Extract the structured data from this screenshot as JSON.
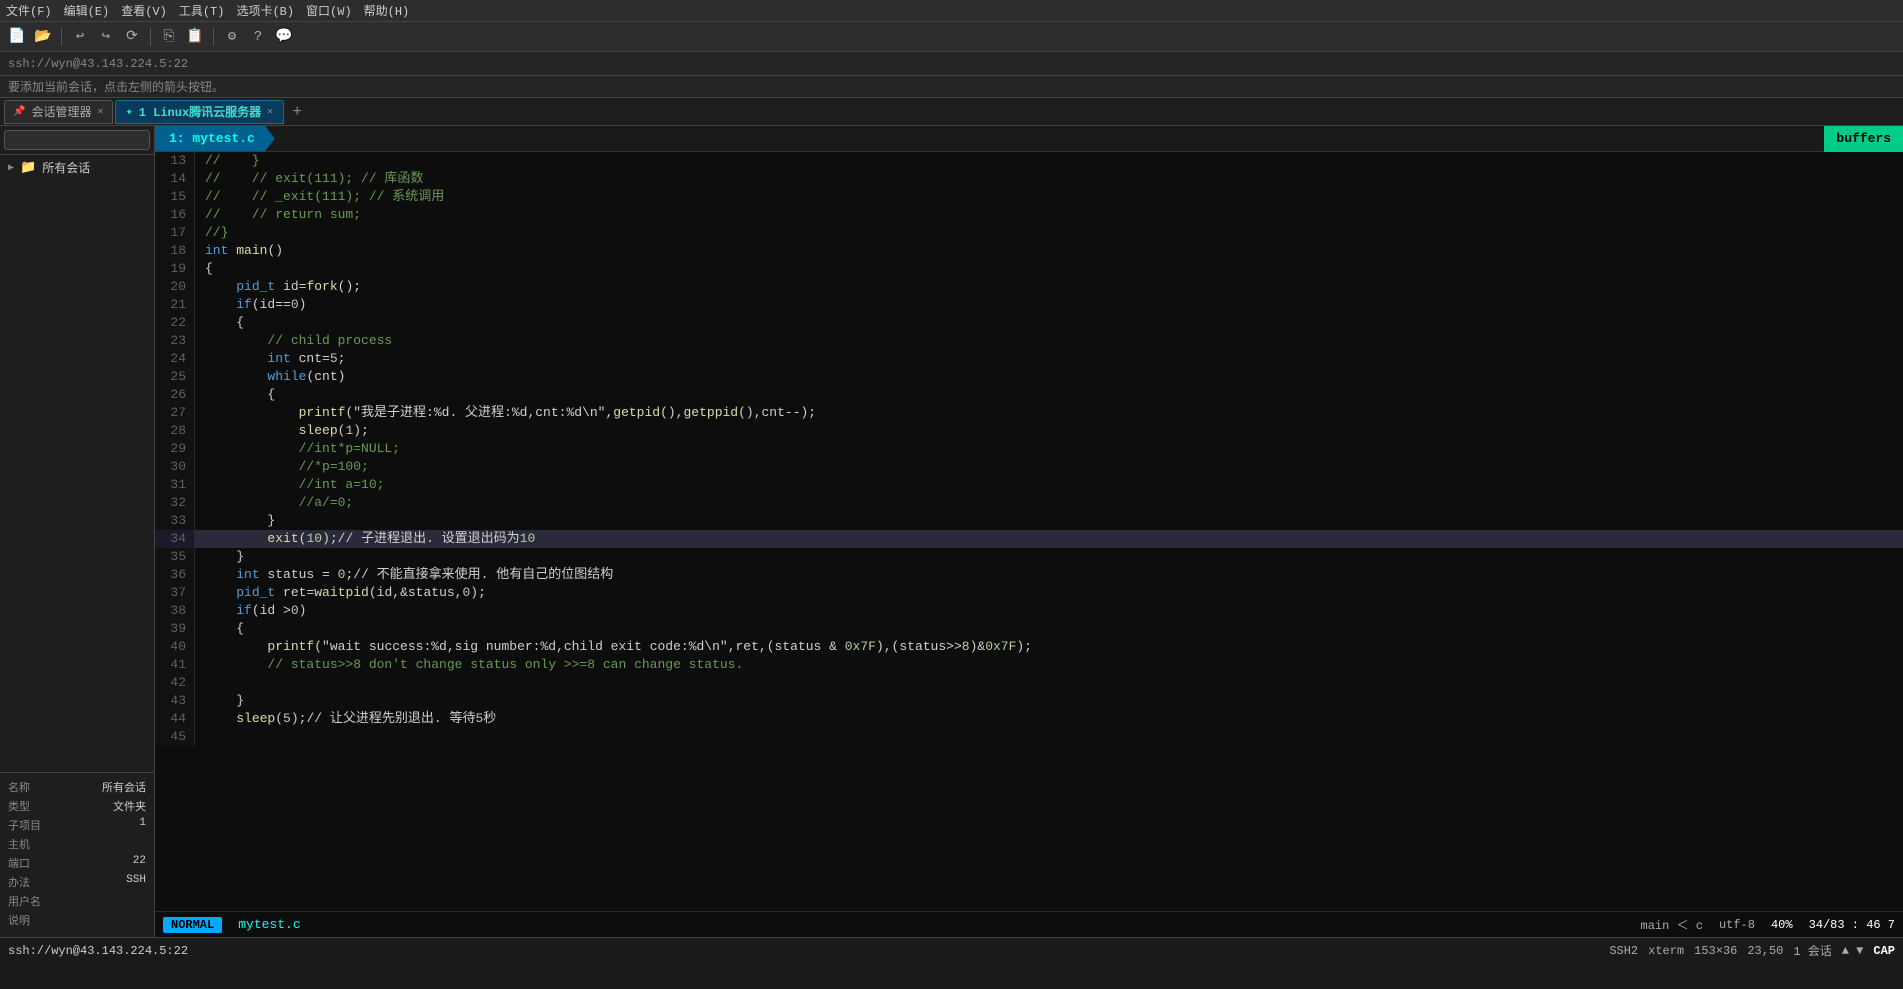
{
  "menubar": {
    "items": [
      "文件(F)",
      "编辑(E)",
      "查看(V)",
      "工具(T)",
      "选项卡(B)",
      "窗口(W)",
      "帮助(H)"
    ]
  },
  "address_bar": {
    "text": "ssh://wyn@43.143.224.5:22"
  },
  "hint_bar": {
    "text": "要添加当前会话，点击左侧的箭头按钮。"
  },
  "tabs": {
    "session_manager": "会话管理器",
    "main_tab": "1 Linux腾讯云服务器",
    "add_btn": "+"
  },
  "editor": {
    "file_tab": "1: mytest.c",
    "buffers_label": "buffers"
  },
  "sidebar": {
    "search_placeholder": "",
    "folder_label": "所有会话",
    "info": {
      "name_label": "名称",
      "name_value": "所有会话",
      "type_label": "类型",
      "type_value": "文件夹",
      "project_label": "子项目",
      "project_value": "1",
      "host_label": "主机",
      "host_value": "",
      "port_label": "端口",
      "port_value": "22",
      "method_label": "办法",
      "method_value": "SSH",
      "username_label": "用户名",
      "username_value": "",
      "note_label": "说明",
      "note_value": ""
    }
  },
  "code": {
    "lines": [
      {
        "num": "13",
        "content": "//    }"
      },
      {
        "num": "14",
        "content": "//    // exit(111); // 库函数"
      },
      {
        "num": "15",
        "content": "//    // _exit(111); // 系统调用"
      },
      {
        "num": "16",
        "content": "//    // return sum;"
      },
      {
        "num": "17",
        "content": "//}"
      },
      {
        "num": "18",
        "content": "int main()"
      },
      {
        "num": "19",
        "content": "{"
      },
      {
        "num": "20",
        "content": "    pid_t id=fork();"
      },
      {
        "num": "21",
        "content": "    if(id==0)"
      },
      {
        "num": "22",
        "content": "    {"
      },
      {
        "num": "23",
        "content": "        // child process"
      },
      {
        "num": "24",
        "content": "        int cnt=5;"
      },
      {
        "num": "25",
        "content": "        while(cnt)"
      },
      {
        "num": "26",
        "content": "        {"
      },
      {
        "num": "27",
        "content": "            printf(\"我是子进程:%d. 父进程:%d,cnt:%d\\n\",getpid(),getppid(),cnt--);"
      },
      {
        "num": "28",
        "content": "            sleep(1);"
      },
      {
        "num": "29",
        "content": "            //int*p=NULL;"
      },
      {
        "num": "30",
        "content": "            //*p=100;"
      },
      {
        "num": "31",
        "content": "            //int a=10;"
      },
      {
        "num": "32",
        "content": "            //a/=0;"
      },
      {
        "num": "33",
        "content": "        }"
      },
      {
        "num": "34",
        "content": "        exit(10);// 子进程退出. 设置退出码为10",
        "highlight": true
      },
      {
        "num": "35",
        "content": "    }"
      },
      {
        "num": "36",
        "content": "    int status = 0;// 不能直接拿来使用. 他有自己的位图结构"
      },
      {
        "num": "37",
        "content": "    pid_t ret=waitpid(id,&status,0);"
      },
      {
        "num": "38",
        "content": "    if(id >0)"
      },
      {
        "num": "39",
        "content": "    {"
      },
      {
        "num": "40",
        "content": "        printf(\"wait success:%d,sig number:%d,child exit code:%d\\n\",ret,(status & 0x7F),(status>>8)&0x7F);"
      },
      {
        "num": "41",
        "content": "        // status>>8 don't change status only >>=8 can change status."
      },
      {
        "num": "42",
        "content": ""
      },
      {
        "num": "43",
        "content": "    }"
      },
      {
        "num": "44",
        "content": "    sleep(5);// 让父进程先别退出. 等待5秒"
      },
      {
        "num": "45",
        "content": ""
      }
    ]
  },
  "status_bar": {
    "mode": "NORMAL",
    "filename": "mytest.c",
    "func": "main ＜ c",
    "encoding": "utf-8",
    "percent": "40%",
    "position": "34/83 : 46",
    "col": "7"
  },
  "bottom_bar": {
    "ssh": "ssh://wyn@43.143.224.5:22",
    "protocol": "SSH2",
    "term": "xterm",
    "size": "153×36",
    "pos": "23,50",
    "sessions": "1 会话",
    "arrows": "▲ ▼",
    "cap": "CAP"
  }
}
